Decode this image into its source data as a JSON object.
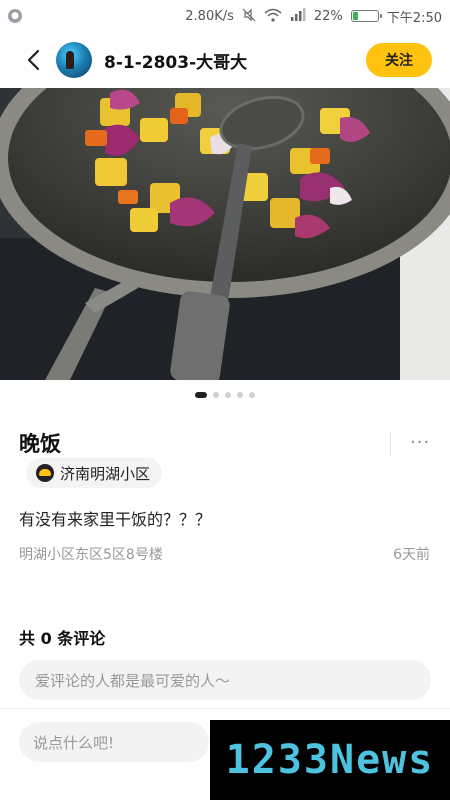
{
  "status_bar": {
    "network_speed": "2.80K/s",
    "battery_percent": "22%",
    "battery_level": 0.22,
    "time": "下午2:50",
    "icons": [
      "notification-icon",
      "mute-icon",
      "wifi-icon",
      "signal-icon",
      "battery-icon"
    ]
  },
  "header": {
    "username": "8-1-2803-大哥大",
    "follow_label": "关注"
  },
  "carousel": {
    "total": 5,
    "active_index": 0
  },
  "post": {
    "title": "晚饭",
    "location": "济南明湖小区",
    "description": "有没有来家里干饭的？？？",
    "address": "明湖小区东区5区8号楼",
    "time_ago": "6天前",
    "more_label": "···"
  },
  "comments": {
    "title": "共 0 条评论",
    "placeholder": "爱评论的人都是最可爱的人～"
  },
  "bottom_bar": {
    "input_placeholder": "说点什么吧!"
  },
  "watermark": {
    "text": "1233News"
  },
  "colors": {
    "accent": "#ffc20e",
    "battery": "#38b24a",
    "watermark_text": "#4ec3e0"
  }
}
